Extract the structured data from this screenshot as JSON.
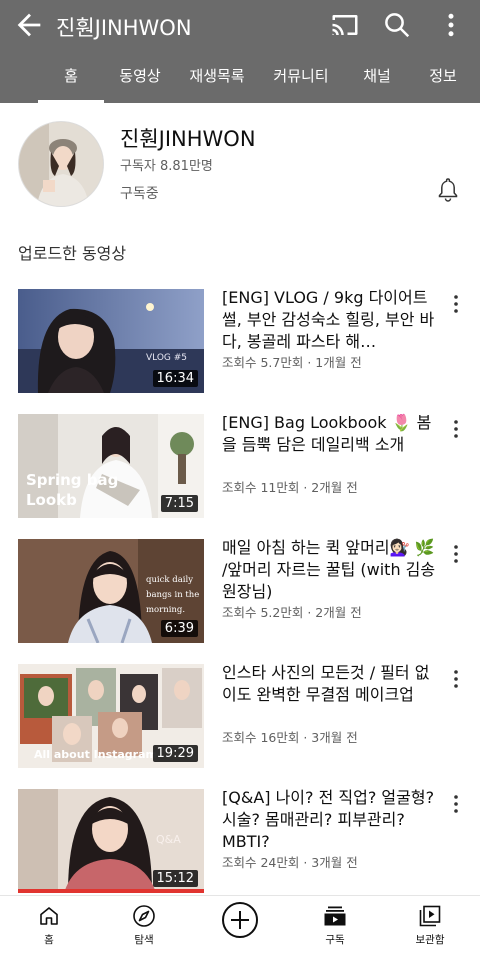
{
  "header": {
    "title": "진훤JINHWON",
    "back_icon": "back-arrow-icon",
    "cast_icon": "cast-icon",
    "search_icon": "search-icon",
    "more_icon": "more-vertical-icon",
    "bg_color": "#6b6b6b"
  },
  "tabs": [
    {
      "label": "홈",
      "active": true
    },
    {
      "label": "동영상"
    },
    {
      "label": "재생목록"
    },
    {
      "label": "커뮤니티"
    },
    {
      "label": "채널"
    },
    {
      "label": "정보"
    }
  ],
  "channel": {
    "name": "진훤JINHWON",
    "subscribers": "구독자 8.81만명",
    "subscribed_label": "구독중"
  },
  "section_title": "업로드한 동영상",
  "videos": [
    {
      "title": "[ENG] VLOG / 9kg 다이어트썰, 부안 감성숙소 힐링, 부안 바다, 봉골레 파스타 해…",
      "meta": "조회수 5.7만회 · 1개월 전",
      "duration": "16:34",
      "thumb_text": "VLOG #5"
    },
    {
      "title": "[ENG] Bag Lookbook 🌷 봄을 듬뿍 담은 데일리백 소개",
      "meta": "조회수 11만회 · 2개월 전",
      "duration": "7:15",
      "thumb_text": "Spring bag Lookb"
    },
    {
      "title": "매일 아침 하는 퀵 앞머리💇🏻‍♀️ 🌿 /앞머리 자르는 꿀팁 (with 김송원장님)",
      "meta": "조회수 5.2만회 · 2개월 전",
      "duration": "6:39",
      "thumb_text": "quick daily bangs in the morning."
    },
    {
      "title": "인스타 사진의 모든것 / 필터 없이도 완벽한 무결점 메이크업",
      "meta": "조회수 16만회 · 3개월 전",
      "duration": "19:29",
      "thumb_text": "All about Instagram"
    },
    {
      "title": "[Q&A] 나이? 전 직업? 얼굴형? 시술? 몸매관리? 피부관리? MBTI?",
      "meta": "조회수 24만회 · 3개월 전",
      "duration": "15:12",
      "thumb_text": "Q&A"
    }
  ],
  "bottom_nav": [
    {
      "label": "홈",
      "icon": "home-icon"
    },
    {
      "label": "탐색",
      "icon": "explore-icon"
    },
    {
      "label": "",
      "icon": "create-icon"
    },
    {
      "label": "구독",
      "icon": "subscriptions-icon"
    },
    {
      "label": "보관함",
      "icon": "library-icon"
    }
  ]
}
